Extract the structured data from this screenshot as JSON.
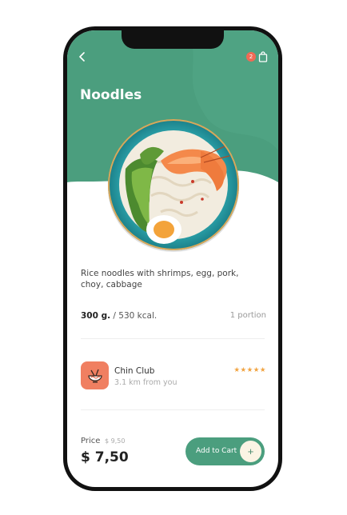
{
  "header": {
    "title": "Noodles",
    "cart_count": "2",
    "back_icon": "chevron-left-icon",
    "cart_icon": "shopping-bag-icon"
  },
  "product": {
    "description": "Rice noodles with shrimps, egg, pork, choy, cabbage",
    "weight": "300 g.",
    "calories": "/ 530 kcal.",
    "portion": "1 portion"
  },
  "restaurant": {
    "name": "Chin Club",
    "distance": "3.1  km from you",
    "stars": "★★★★★",
    "rating": 5
  },
  "purchase": {
    "price_label": "Price",
    "old_price": "$ 9,50",
    "price": "$ 7,50",
    "add_to_cart_label": "Add to Cart",
    "add_icon": "plus-icon"
  },
  "colors": {
    "header_green": "#4b9e7e",
    "accent_orange": "#f07f61",
    "badge_red": "#f06a55",
    "star_yellow": "#f1a340"
  }
}
